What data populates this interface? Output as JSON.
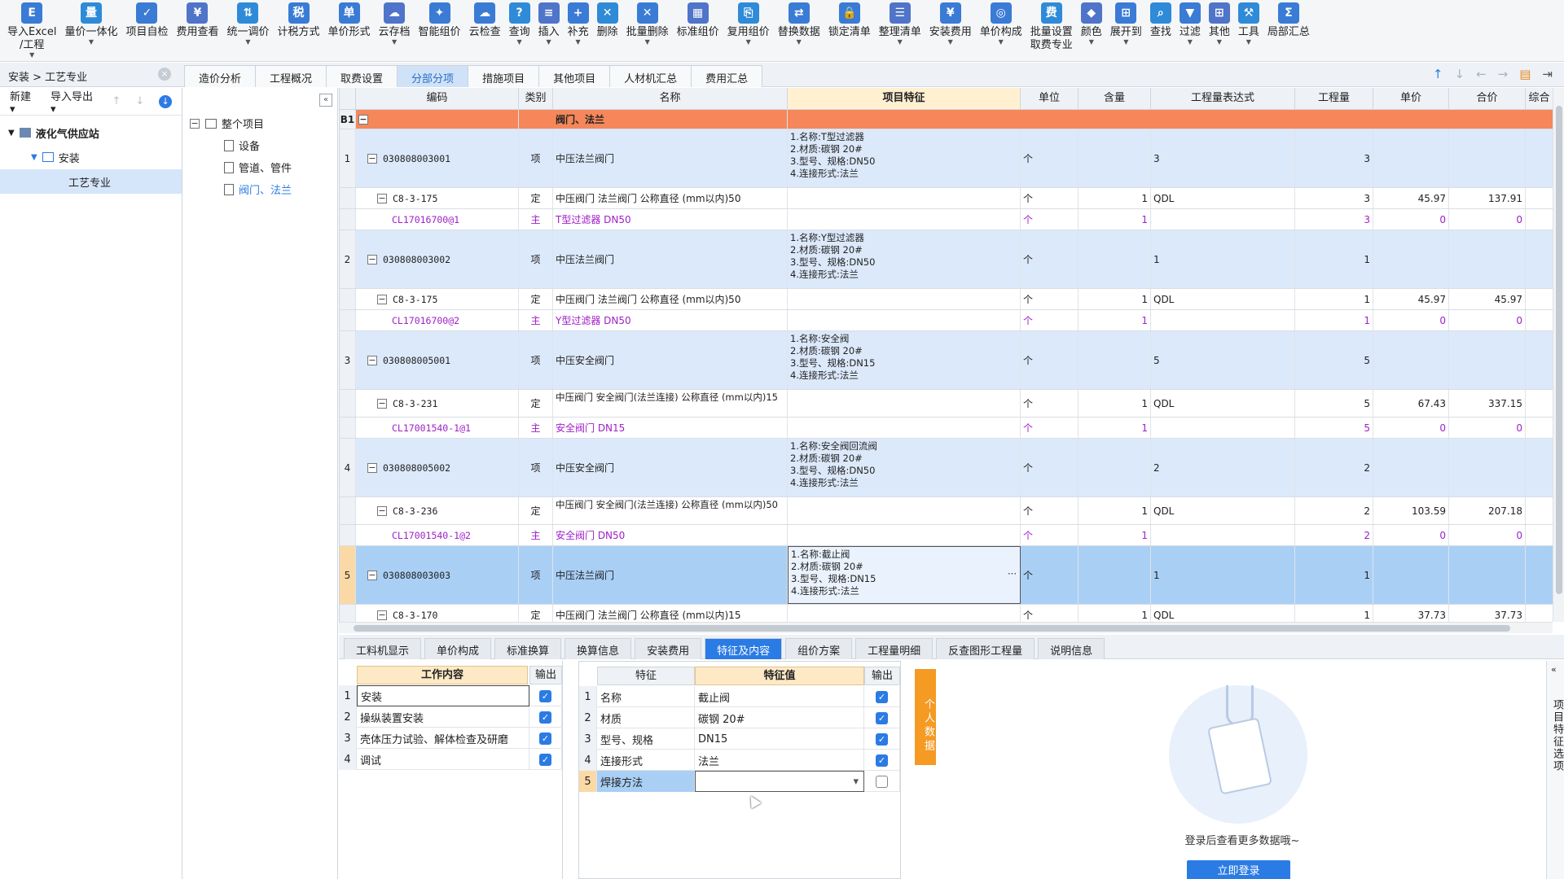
{
  "toolbar": [
    {
      "label": "导入Excel\n/工程",
      "icon": "import-excel-icon",
      "arrow": true
    },
    {
      "label": "量价一体化",
      "icon": "integration-icon",
      "arrow": true
    },
    {
      "label": "项目自检",
      "icon": "self-check-icon",
      "arrow": false
    },
    {
      "label": "费用查看",
      "icon": "cost-view-icon",
      "arrow": false
    },
    {
      "label": "统一调价",
      "icon": "price-adjust-icon",
      "arrow": true
    },
    {
      "label": "计税方式",
      "icon": "tax-method-icon",
      "arrow": false
    },
    {
      "label": "单价形式",
      "icon": "unit-price-form-icon",
      "arrow": false
    },
    {
      "label": "云存档",
      "icon": "cloud-archive-icon",
      "arrow": true
    },
    {
      "label": "智能组价",
      "icon": "smart-pricing-icon",
      "arrow": false
    },
    {
      "label": "云检查",
      "icon": "cloud-check-icon",
      "arrow": false
    },
    {
      "label": "查询",
      "icon": "query-icon",
      "arrow": true
    },
    {
      "label": "插入",
      "icon": "insert-icon",
      "arrow": true
    },
    {
      "label": "补充",
      "icon": "supplement-icon",
      "arrow": true
    },
    {
      "label": "删除",
      "icon": "delete-icon",
      "arrow": false
    },
    {
      "label": "批量删除",
      "icon": "batch-delete-icon",
      "arrow": true
    },
    {
      "label": "标准组价",
      "icon": "standard-pricing-icon",
      "arrow": false
    },
    {
      "label": "复用组价",
      "icon": "reuse-pricing-icon",
      "arrow": true
    },
    {
      "label": "替换数据",
      "icon": "replace-data-icon",
      "arrow": true
    },
    {
      "label": "锁定清单",
      "icon": "lock-list-icon",
      "arrow": false
    },
    {
      "label": "整理清单",
      "icon": "organize-list-icon",
      "arrow": true
    },
    {
      "label": "安装费用",
      "icon": "install-fee-icon",
      "arrow": true
    },
    {
      "label": "单价构成",
      "icon": "unit-price-composition-icon",
      "arrow": true
    },
    {
      "label": "批量设置\n取费专业",
      "icon": "batch-settings-icon",
      "arrow": false
    },
    {
      "label": "颜色",
      "icon": "color-icon",
      "arrow": true
    },
    {
      "label": "展开到",
      "icon": "expand-to-icon",
      "arrow": true
    },
    {
      "label": "查找",
      "icon": "find-icon",
      "arrow": false
    },
    {
      "label": "过滤",
      "icon": "filter-icon",
      "arrow": true
    },
    {
      "label": "其他",
      "icon": "other-icon",
      "arrow": true
    },
    {
      "label": "工具",
      "icon": "tools-icon",
      "arrow": true
    },
    {
      "label": "局部汇总",
      "icon": "partial-summary-icon",
      "arrow": false
    }
  ],
  "breadcrumb": "安装 > 工艺专业",
  "top_tabs": [
    "造价分析",
    "工程概况",
    "取费设置",
    "分部分项",
    "措施项目",
    "其他项目",
    "人材机汇总",
    "费用汇总"
  ],
  "top_tab_active": 3,
  "left": {
    "new_label": "新建",
    "import_export_label": "导入导出",
    "tree": [
      "液化气供应站",
      "安装",
      "工艺专业"
    ]
  },
  "mid_tree": {
    "root": "整个项目",
    "items": [
      "设备",
      "管道、管件",
      "阀门、法兰"
    ]
  },
  "grid": {
    "headers": [
      "编码",
      "类别",
      "名称",
      "项目特征",
      "单位",
      "含量",
      "工程量表达式",
      "工程量",
      "单价",
      "合价",
      "综合"
    ],
    "group": {
      "num": "B1",
      "name": "阀门、法兰"
    },
    "rows": [
      {
        "type": "xiang",
        "num": "1",
        "code": "030808003001",
        "cat": "项",
        "name": "中压法兰阀门",
        "feature": "1.名称:T型过滤器\n2.材质:碳钢 20#\n3.型号、规格:DN50\n4.连接形式:法兰",
        "unit": "个",
        "content": "",
        "expr": "3",
        "qty": "3",
        "price": "",
        "total": ""
      },
      {
        "type": "ding",
        "num": "",
        "code": "C8-3-175",
        "cat": "定",
        "name": "中压阀门 法兰阀门 公称直径 (mm以内)50",
        "feature": "",
        "unit": "个",
        "content": "1",
        "expr": "QDL",
        "qty": "3",
        "price": "45.97",
        "total": "137.91"
      },
      {
        "type": "zhu",
        "num": "",
        "code": "CL17016700@1",
        "cat": "主",
        "name": "T型过滤器 DN50",
        "feature": "",
        "unit": "个",
        "content": "1",
        "expr": "",
        "qty": "3",
        "price": "0",
        "total": "0"
      },
      {
        "type": "xiang",
        "num": "2",
        "code": "030808003002",
        "cat": "项",
        "name": "中压法兰阀门",
        "feature": "1.名称:Y型过滤器\n2.材质:碳钢 20#\n3.型号、规格:DN50\n4.连接形式:法兰",
        "unit": "个",
        "content": "",
        "expr": "1",
        "qty": "1",
        "price": "",
        "total": ""
      },
      {
        "type": "ding",
        "num": "",
        "code": "C8-3-175",
        "cat": "定",
        "name": "中压阀门 法兰阀门 公称直径 (mm以内)50",
        "feature": "",
        "unit": "个",
        "content": "1",
        "expr": "QDL",
        "qty": "1",
        "price": "45.97",
        "total": "45.97"
      },
      {
        "type": "zhu",
        "num": "",
        "code": "CL17016700@2",
        "cat": "主",
        "name": "Y型过滤器 DN50",
        "feature": "",
        "unit": "个",
        "content": "1",
        "expr": "",
        "qty": "1",
        "price": "0",
        "total": "0"
      },
      {
        "type": "xiang",
        "num": "3",
        "code": "030808005001",
        "cat": "项",
        "name": "中压安全阀门",
        "feature": "1.名称:安全阀\n2.材质:碳钢 20#\n3.型号、规格:DN15\n4.连接形式:法兰",
        "unit": "个",
        "content": "",
        "expr": "5",
        "qty": "5",
        "price": "",
        "total": ""
      },
      {
        "type": "ding",
        "num": "",
        "code": "C8-3-231",
        "cat": "定",
        "name": "中压阀门 安全阀门(法兰连接) 公称直径 (mm以内)15",
        "feature": "",
        "unit": "个",
        "content": "1",
        "expr": "QDL",
        "qty": "5",
        "price": "67.43",
        "total": "337.15"
      },
      {
        "type": "zhu",
        "num": "",
        "code": "CL17001540-1@1",
        "cat": "主",
        "name": "安全阀门 DN15",
        "feature": "",
        "unit": "个",
        "content": "1",
        "expr": "",
        "qty": "5",
        "price": "0",
        "total": "0"
      },
      {
        "type": "xiang",
        "num": "4",
        "code": "030808005002",
        "cat": "项",
        "name": "中压安全阀门",
        "feature": "1.名称:安全阀回流阀\n2.材质:碳钢 20#\n3.型号、规格:DN50\n4.连接形式:法兰",
        "unit": "个",
        "content": "",
        "expr": "2",
        "qty": "2",
        "price": "",
        "total": ""
      },
      {
        "type": "ding",
        "num": "",
        "code": "C8-3-236",
        "cat": "定",
        "name": "中压阀门 安全阀门(法兰连接) 公称直径 (mm以内)50",
        "feature": "",
        "unit": "个",
        "content": "1",
        "expr": "QDL",
        "qty": "2",
        "price": "103.59",
        "total": "207.18"
      },
      {
        "type": "zhu",
        "num": "",
        "code": "CL17001540-1@2",
        "cat": "主",
        "name": "安全阀门 DN50",
        "feature": "",
        "unit": "个",
        "content": "1",
        "expr": "",
        "qty": "2",
        "price": "0",
        "total": "0"
      },
      {
        "type": "sel",
        "num": "5",
        "code": "030808003003",
        "cat": "项",
        "name": "中压法兰阀门",
        "feature": "1.名称:截止阀\n2.材质:碳钢 20#\n3.型号、规格:DN15\n4.连接形式:法兰",
        "unit": "个",
        "content": "",
        "expr": "1",
        "qty": "1",
        "price": "",
        "total": ""
      },
      {
        "type": "ding",
        "num": "",
        "code": "C8-3-170",
        "cat": "定",
        "name": "中压阀门 法兰阀门 公称直径 (mm以内)15",
        "feature": "",
        "unit": "个",
        "content": "1",
        "expr": "QDL",
        "qty": "1",
        "price": "37.73",
        "total": "37.73"
      }
    ]
  },
  "bottom_tabs": [
    "工料机显示",
    "单价构成",
    "标准换算",
    "换算信息",
    "安装费用",
    "特征及内容",
    "组价方案",
    "工程量明细",
    "反查图形工程量",
    "说明信息"
  ],
  "bottom_tab_active": 5,
  "work": {
    "headers": [
      "工作内容",
      "输出"
    ],
    "rows": [
      "安装",
      "操纵装置安装",
      "壳体压力试验、解体检查及研磨",
      "调试"
    ]
  },
  "feature": {
    "headers": [
      "特征",
      "特征值",
      "输出"
    ],
    "rows": [
      {
        "name": "名称",
        "value": "截止阀",
        "checked": true
      },
      {
        "name": "材质",
        "value": "碳钢 20#",
        "checked": true
      },
      {
        "name": "型号、规格",
        "value": "DN15",
        "checked": true
      },
      {
        "name": "连接形式",
        "value": "法兰",
        "checked": true
      },
      {
        "name": "焊接方法",
        "value": "",
        "checked": false
      }
    ]
  },
  "person_tab": "个人数据",
  "login": {
    "text": "登录后查看更多数据哦~",
    "button": "立即登录"
  },
  "right_vertical_tab": "项目特征选项",
  "colors": {
    "group_row": "#f5875b",
    "selected_row": "#a9cff5",
    "item_row": "#dce9fb",
    "accent": "#2b7be4",
    "main_material": "#a020c8"
  }
}
